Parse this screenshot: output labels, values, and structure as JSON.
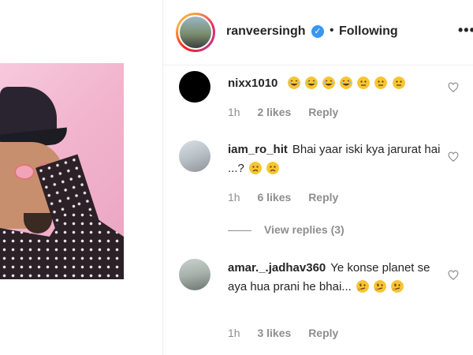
{
  "header": {
    "username": "ranveersingh",
    "separator": "•",
    "follow_status": "Following",
    "more_label": "•••"
  },
  "comments": [
    {
      "username": "nixx1010",
      "text": "",
      "emojis": [
        "laughing",
        "laughing",
        "laughing",
        "laughing",
        "neutral",
        "neutral",
        "neutral"
      ],
      "time": "1h",
      "likes": "2 likes",
      "reply": "Reply"
    },
    {
      "username": "iam_ro_hit",
      "text": "Bhai yaar iski kya jarurat hai ...?",
      "emojis": [
        "frowning",
        "frowning"
      ],
      "time": "1h",
      "likes": "6 likes",
      "reply": "Reply",
      "view_replies": "View replies (3)"
    },
    {
      "username": "amar._.jadhav360",
      "text": "Ye konse planet se aya hua prani he bhai...",
      "emojis": [
        "confused",
        "confused",
        "confused"
      ],
      "time": "1h",
      "likes": "3 likes",
      "reply": "Reply"
    }
  ],
  "colors": {
    "text": "#262626",
    "muted": "#8e8e8e",
    "verified": "#3897f0",
    "emoji": "#f7c531"
  },
  "icons": {
    "verified": "verified-badge-icon",
    "heart": "heart-outline-icon",
    "more": "more-options-icon"
  }
}
